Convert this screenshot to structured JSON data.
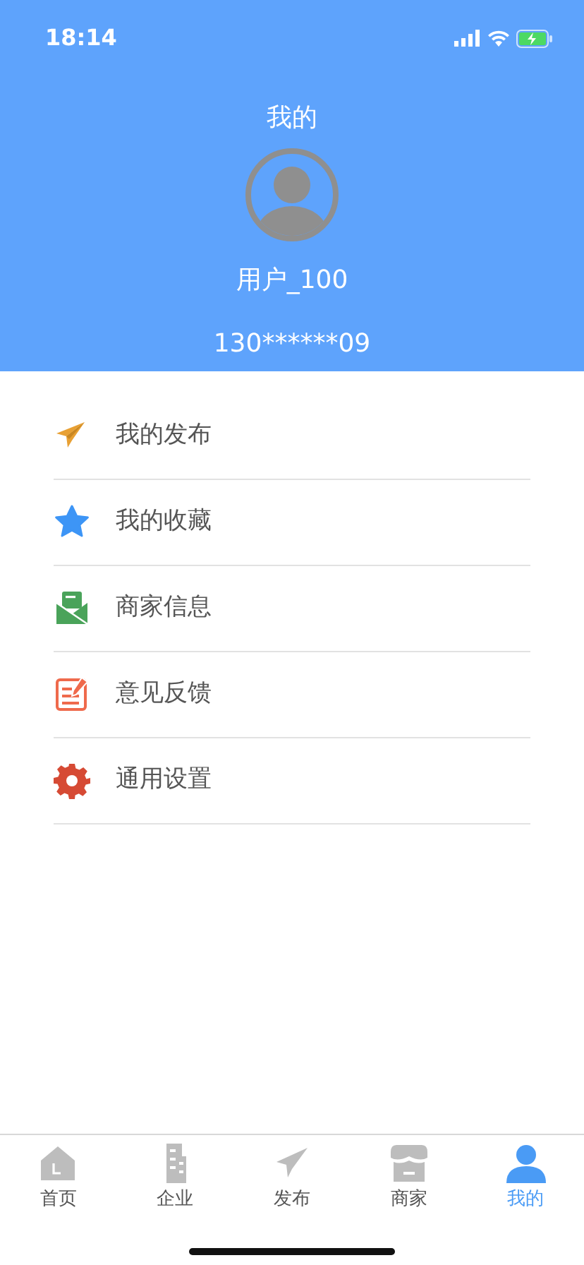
{
  "status_bar": {
    "time": "18:14"
  },
  "header": {
    "title": "我的",
    "username": "用户_100",
    "phone": "130******09"
  },
  "menu": [
    {
      "kind": "plane",
      "label": "我的发布"
    },
    {
      "kind": "star",
      "label": "我的收藏"
    },
    {
      "kind": "mail",
      "label": "商家信息"
    },
    {
      "kind": "note",
      "label": "意见反馈"
    },
    {
      "kind": "gear",
      "label": "通用设置"
    }
  ],
  "tab_bar": [
    {
      "kind": "home",
      "label": "首页",
      "selected": false
    },
    {
      "kind": "building",
      "label": "企业",
      "selected": false
    },
    {
      "kind": "plane",
      "label": "发布",
      "selected": false
    },
    {
      "kind": "shop",
      "label": "商家",
      "selected": false
    },
    {
      "kind": "person",
      "label": "我的",
      "selected": true
    }
  ]
}
